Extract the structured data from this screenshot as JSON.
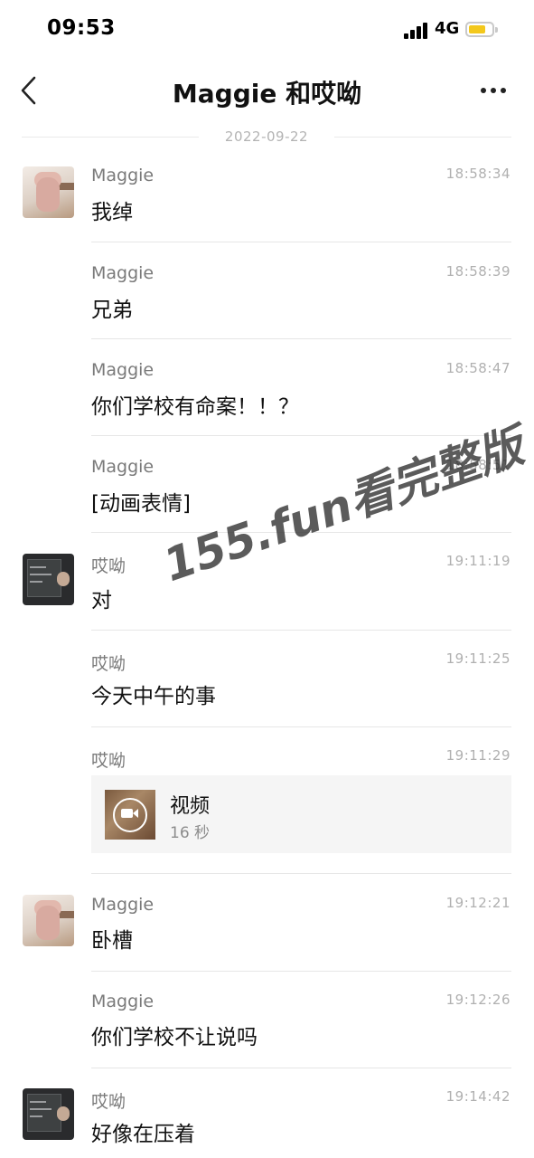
{
  "status_bar": {
    "time": "09:53",
    "network": "4G",
    "battery_level": 0.75,
    "battery_color": "#f3c81c"
  },
  "nav": {
    "title": "Maggie 和哎呦",
    "back_icon": "chevron-left-icon",
    "more_icon": "more-horizontal-icon"
  },
  "date_divider": "2022-09-22",
  "messages": [
    {
      "sender": "Maggie",
      "time": "18:58:34",
      "text": "我绰",
      "avatar": "avatar-pig"
    },
    {
      "sender": "Maggie",
      "time": "18:58:39",
      "text": "兄弟"
    },
    {
      "sender": "Maggie",
      "time": "18:58:47",
      "text": "你们学校有命案！！？"
    },
    {
      "sender": "Maggie",
      "time": "18:58:51",
      "text": "[动画表情]"
    },
    {
      "sender": "哎呦",
      "time": "19:11:19",
      "text": "对",
      "avatar": "avatar-dark"
    },
    {
      "sender": "哎呦",
      "time": "19:11:25",
      "text": "今天中午的事"
    },
    {
      "sender": "哎呦",
      "time": "19:11:29",
      "video": {
        "title": "视频",
        "duration": "16 秒"
      }
    },
    {
      "sender": "Maggie",
      "time": "19:12:21",
      "text": "卧槽",
      "avatar": "avatar-pig"
    },
    {
      "sender": "Maggie",
      "time": "19:12:26",
      "text": "你们学校不让说吗"
    },
    {
      "sender": "哎呦",
      "time": "19:14:42",
      "text": "好像在压着",
      "avatar": "avatar-dark"
    }
  ],
  "watermark": "155.fun看完整版"
}
